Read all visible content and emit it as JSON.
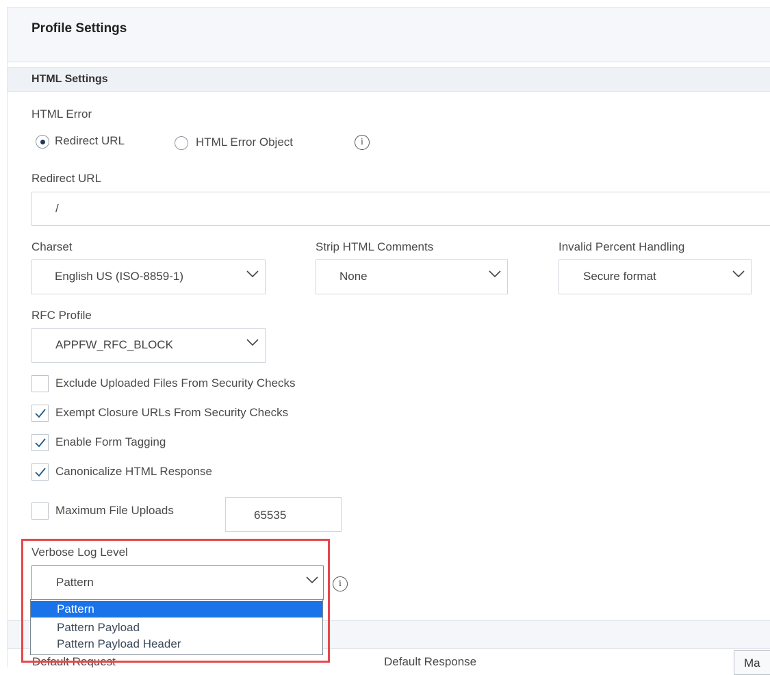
{
  "profile": {
    "title": "Profile Settings"
  },
  "html_settings": {
    "title": "HTML Settings",
    "html_error": {
      "label": "HTML Error",
      "options": [
        "Redirect URL",
        "HTML Error Object"
      ],
      "selected": "Redirect URL",
      "info_icon": "info-icon"
    },
    "redirect_url": {
      "label": "Redirect URL",
      "value": "/"
    },
    "charset": {
      "label": "Charset",
      "value": "English US (ISO-8859-1)"
    },
    "strip_comments": {
      "label": "Strip HTML Comments",
      "value": "None"
    },
    "invalid_percent": {
      "label": "Invalid Percent Handling",
      "value": "Secure format"
    },
    "rfc_profile": {
      "label": "RFC Profile",
      "value": "APPFW_RFC_BLOCK"
    },
    "checkboxes": [
      {
        "label": "Exclude Uploaded Files From Security Checks",
        "checked": false
      },
      {
        "label": "Exempt Closure URLs From Security Checks",
        "checked": true
      },
      {
        "label": "Enable Form Tagging",
        "checked": true
      },
      {
        "label": "Canonicalize HTML Response",
        "checked": true
      }
    ],
    "max_uploads": {
      "label": "Maximum File Uploads",
      "checked": false,
      "value": "65535"
    },
    "verbose_log": {
      "label": "Verbose Log Level",
      "value": "Pattern",
      "options": [
        "Pattern",
        "Pattern Payload",
        "Pattern Payload Header"
      ],
      "selected_option": "Pattern"
    }
  },
  "lower": {
    "default_request_label": "Default Request",
    "default_response_label": "Default Response",
    "button_label": "Ma"
  },
  "colors": {
    "highlight_border": "#e8464a",
    "selected_option_bg": "#1a73e8",
    "check_color": "#1b5a8a"
  }
}
